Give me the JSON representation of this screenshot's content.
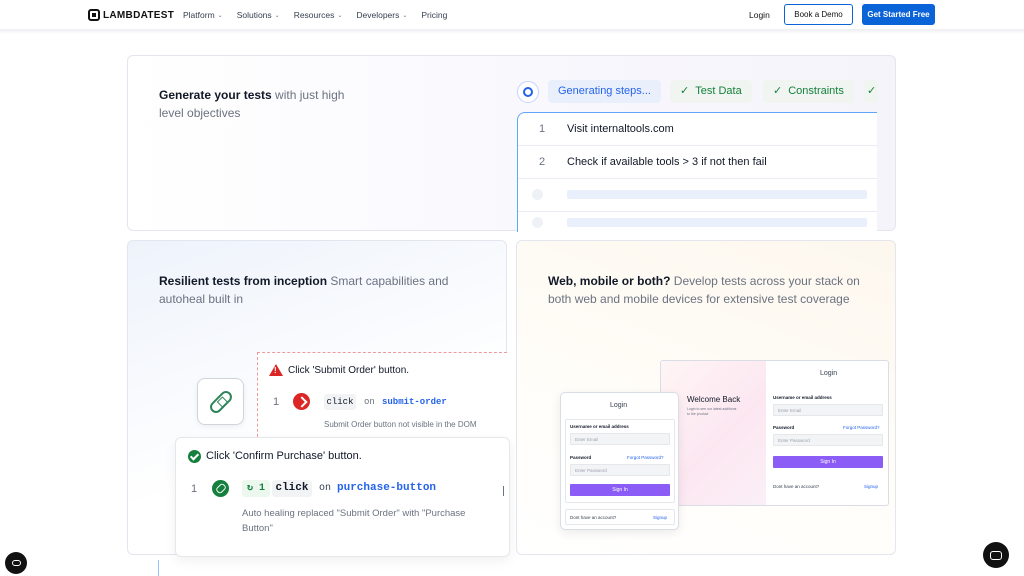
{
  "nav": {
    "logo": "LAMBDATEST",
    "menu": [
      "Platform",
      "Solutions",
      "Resources",
      "Developers",
      "Pricing"
    ],
    "menu_dropdown": [
      true,
      true,
      true,
      true,
      false
    ],
    "login": "Login",
    "demo": "Book a Demo",
    "free": "Get Started Free"
  },
  "card1": {
    "heading_bold": "Generate your tests",
    "heading_rest": " with just high level objectives",
    "pills": {
      "generating": "Generating steps...",
      "test_data": "Test Data",
      "constraints": "Constraints"
    },
    "steps": [
      {
        "num": "1",
        "text": "Visit internaltools.com"
      },
      {
        "num": "2",
        "text": "Check if available tools > 3 if not then fail"
      }
    ]
  },
  "card2": {
    "heading_bold": "Resilient tests from inception",
    "heading_rest": " Smart capabilities and autoheal built in",
    "error": {
      "title": "Click 'Submit Order' button.",
      "num": "1",
      "action": "click",
      "on": "on",
      "target": "submit-order",
      "message": "Submit Order button not visible in the DOM"
    },
    "success": {
      "title": "Click 'Confirm Purchase' button.",
      "num": "1",
      "retry": "1",
      "action": "click",
      "on": "on",
      "target": "purchase-button",
      "message": "Auto healing replaced \"Submit Order\" with \"Purchase Button\""
    }
  },
  "card3": {
    "heading_bold": "Web, mobile or both?",
    "heading_rest": " Develop tests across your stack on both web and mobile devices for extensive test coverage",
    "desktop": {
      "welcome": "Welcome Back",
      "welcome_sub": "Login to see our latest additions to the product",
      "login_title": "Login",
      "user_label": "Username or email address",
      "user_placeholder": "Enter Email",
      "pass_label": "Password",
      "forgot": "Forgot Password?",
      "pass_placeholder": "Enter Password",
      "sign_in": "Sign In",
      "no_account": "Dont have an account?",
      "signup": "Signup"
    },
    "mobile": {
      "login_title": "Login",
      "user_label": "Username or email address",
      "user_placeholder": "Enter Email",
      "pass_label": "Password",
      "forgot": "Forgot Password?",
      "pass_placeholder": "Enter Password",
      "sign_in": "Sign In",
      "no_account": "Dont have an account?",
      "signup": "Signup"
    }
  },
  "colors": {
    "primary": "#0b63d8",
    "success": "#15803d",
    "error": "#dc2626",
    "accent_purple": "#8b5cf6"
  },
  "icons": [
    "cookie-settings-icon",
    "chat-icon",
    "bandage-icon",
    "warning-icon",
    "check-circle-icon",
    "cursor-click-icon",
    "ai-generate-icon"
  ]
}
